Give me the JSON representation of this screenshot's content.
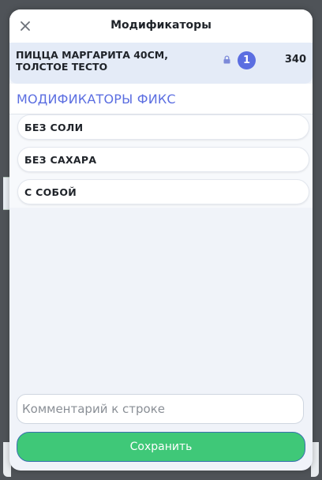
{
  "dialog": {
    "title": "Модификаторы",
    "close_icon": "close-icon"
  },
  "product": {
    "name": "ПИЦЦА МАРГАРИТА 40СМ, ТОЛСТОЕ ТЕСТО",
    "lock_icon": "lock-icon",
    "quantity": "1",
    "price": "340"
  },
  "modifier_group": {
    "title": "МОДИФИКАТОРЫ ФИКС",
    "items": [
      {
        "label": "БЕЗ СОЛИ"
      },
      {
        "label": "БЕЗ САХАРА"
      },
      {
        "label": "С СОБОЙ"
      }
    ]
  },
  "comment": {
    "placeholder": "Комментарий к строке",
    "value": ""
  },
  "save_label": "Сохранить",
  "colors": {
    "accent": "#5b6ee1",
    "save_button": "#3fc878",
    "dialog_bg": "#f0f3f9"
  }
}
